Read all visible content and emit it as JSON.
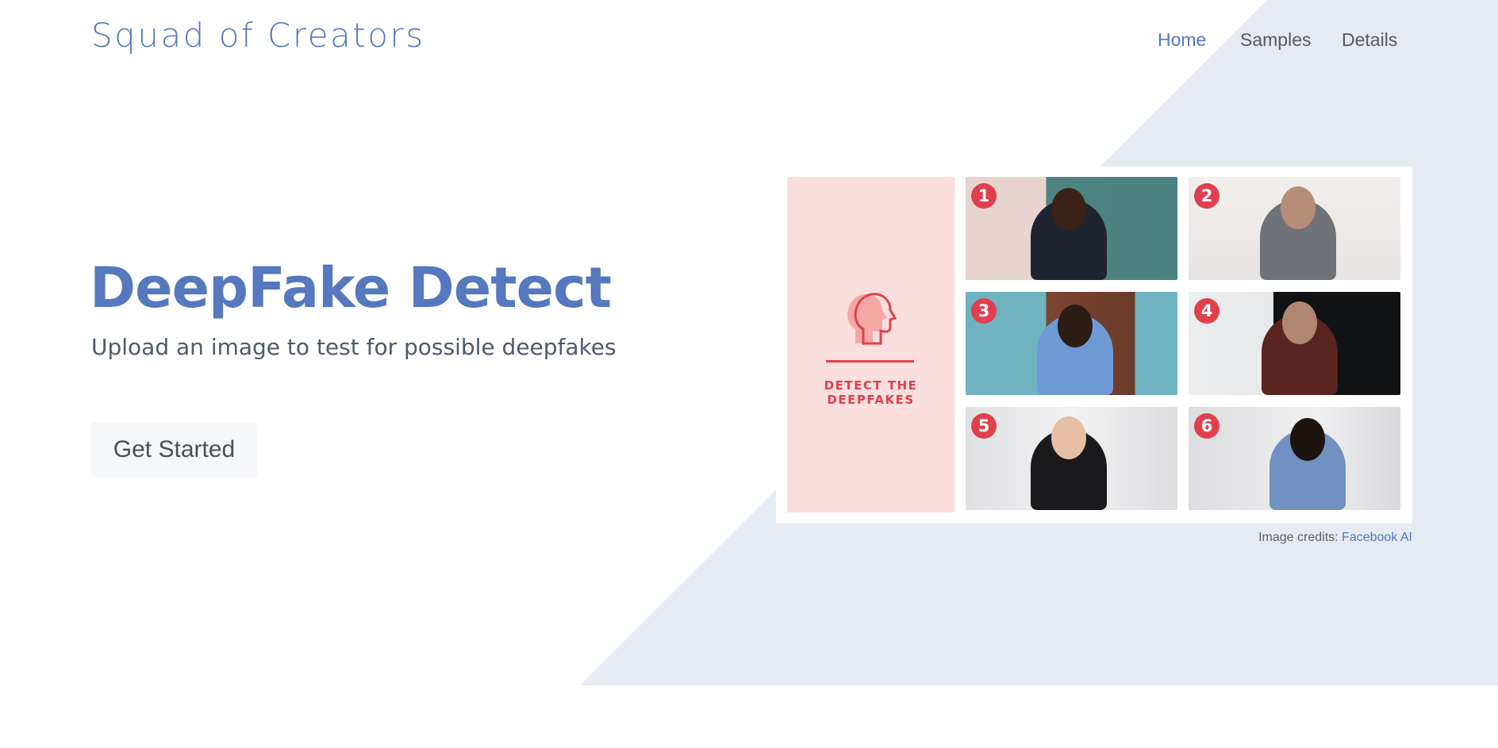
{
  "brand": "Squad of Creators",
  "nav": {
    "home": "Home",
    "samples": "Samples",
    "details": "Details"
  },
  "hero": {
    "title": "DeepFake Detect",
    "subtitle": "Upload an image to test for possible deepfakes",
    "cta": "Get Started"
  },
  "figure": {
    "logo_text_line1": "DETECT THE",
    "logo_text_line2": "DEEPFAKES",
    "tiles": [
      "1",
      "2",
      "3",
      "4",
      "5",
      "6"
    ]
  },
  "credits": {
    "prefix": "Image credits:",
    "link": "Facebook AI"
  },
  "colors": {
    "accent": "#5578be",
    "text": "#4e5a6c",
    "shape": "#e6eaf3",
    "badge": "#e0404e"
  }
}
